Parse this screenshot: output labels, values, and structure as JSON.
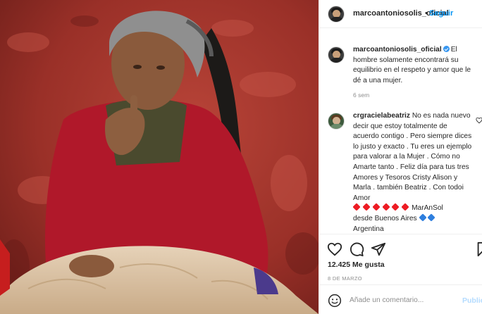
{
  "post": {
    "username": "marcoantoniosolis_oficial",
    "separator": "•",
    "follow_label": "Seguir"
  },
  "caption": {
    "username": "marcoantoniosolis_oficial",
    "text": "El hombre solamente encontrará su equilibrio en el respeto y amor que le dé a una mujer.",
    "time": "6 sem"
  },
  "comment": {
    "username": "crgracielabeatriz",
    "text": "No es nada nuevo decir que estoy totalmente de acuerdo contigo . Pero siempre dices lo justo y exacto . Tu eres un ejemplo para valorar a la Mujer . Cómo no Amarte tanto . Feliz día para tus tres Amores y Tesoros Cristy Alison y Marla . también Beatriz . Con todoi Amor",
    "signature_1": "MarAnSol",
    "signature_2": "desde Buenos Aires",
    "signature_3": "Argentina"
  },
  "actions": {
    "likes": "12.425 Me gusta",
    "date": "8 DE MARZO"
  },
  "add_comment": {
    "placeholder": "Añade un comentario...",
    "publish_label": "Publicar"
  },
  "icons": [
    "heart-icon",
    "comment-icon",
    "share-icon",
    "save-icon",
    "emoji-icon",
    "verified-badge-icon"
  ],
  "colors": {
    "link": "#0095f6",
    "verified": "#3897f0",
    "muted": "#8e8e8e",
    "publish_disabled": "#b3dbff"
  }
}
